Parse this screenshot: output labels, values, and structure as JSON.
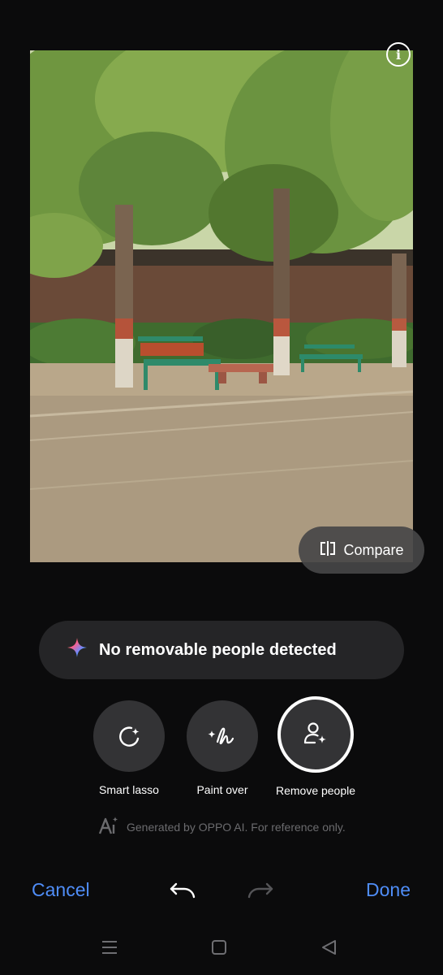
{
  "photo": {
    "alt": "park benches under trees"
  },
  "compare": {
    "label": "Compare"
  },
  "toast": {
    "message": "No removable people detected"
  },
  "tools": [
    {
      "label": "Smart lasso",
      "icon": "smart-lasso-icon"
    },
    {
      "label": "Paint over",
      "icon": "paint-over-icon"
    },
    {
      "label": "Remove people",
      "icon": "remove-people-icon",
      "selected": true
    }
  ],
  "disclaimer": "Generated by OPPO AI. For reference only.",
  "bottom_bar": {
    "cancel": "Cancel",
    "done": "Done"
  },
  "colors": {
    "accent": "#4f8df7",
    "background": "#0b0b0c"
  }
}
